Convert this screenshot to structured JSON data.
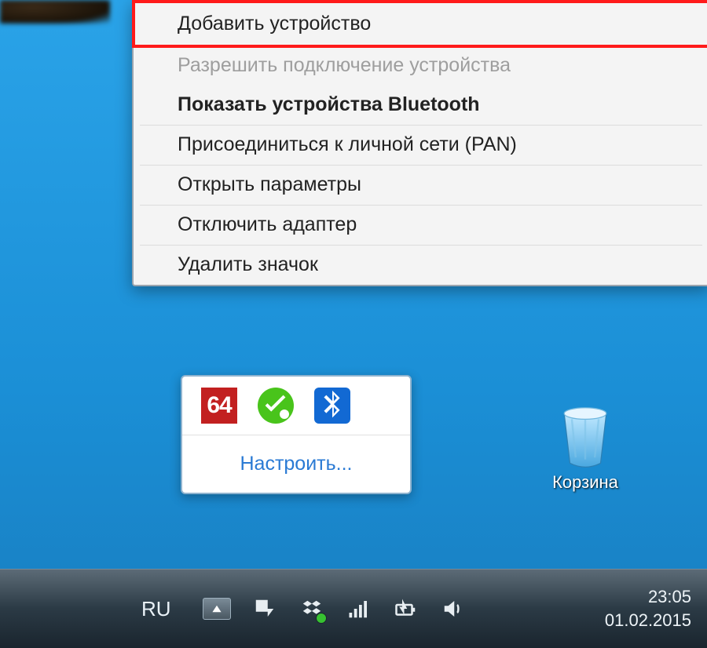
{
  "menu": {
    "add_device": "Добавить устройство",
    "allow_connect": "Разрешить подключение устройства",
    "show_bt": "Показать устройства Bluetooth",
    "join_pan": "Присоединиться к личной сети (PAN)",
    "open_params": "Открыть параметры",
    "disable_adapter": "Отключить адаптер",
    "remove_icon": "Удалить значок"
  },
  "tray_popup": {
    "icon64": "64",
    "customize": "Настроить..."
  },
  "desktop": {
    "recycle_bin": "Корзина"
  },
  "taskbar": {
    "lang": "RU",
    "time": "23:05",
    "date": "01.02.2015"
  }
}
